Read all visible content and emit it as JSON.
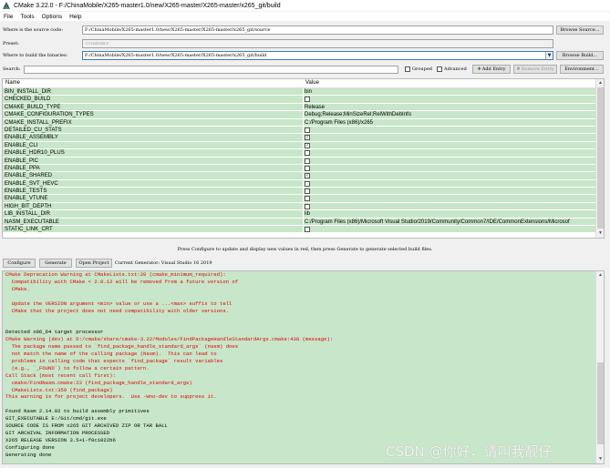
{
  "window": {
    "title": "CMake 3.22.0 - F:/ChinaMobile/X265-master1.0/new/X265-master/X265-master/x265_git/build"
  },
  "menu": [
    "File",
    "Tools",
    "Options",
    "Help"
  ],
  "source": {
    "label": "Where is the source code:",
    "value": "F:/ChinaMobile/X265-master1.0/new/X265-master/X265-master/x265_git/source",
    "button": "Browse Source..."
  },
  "preset": {
    "label": "Preset:",
    "value": "<custom>"
  },
  "binaries": {
    "label": "Where to build the binaries:",
    "value": "F:/ChinaMobile/X265-master1.0/new/X265-master/X265-master/x265_git/build",
    "button": "Browse Build..."
  },
  "search": {
    "label": "Search:",
    "value": "",
    "grouped": "Grouped",
    "advanced": "Advanced",
    "add_entry": "Add Entry",
    "remove_entry": "Remove Entry",
    "environment": "Environment..."
  },
  "table": {
    "headers": {
      "name": "Name",
      "value": "Value"
    },
    "rows": [
      {
        "name": "BIN_INSTALL_DIR",
        "value": "bin"
      },
      {
        "name": "CHECKED_BUILD",
        "checkbox": true,
        "checked": false
      },
      {
        "name": "CMAKE_BUILD_TYPE",
        "value": "Release"
      },
      {
        "name": "CMAKE_CONFIGURATION_TYPES",
        "value": "Debug;Release;MinSizeRel;RelWithDebInfo"
      },
      {
        "name": "CMAKE_INSTALL_PREFIX",
        "value": "C:/Program Files (x86)/x265"
      },
      {
        "name": "DETAILED_CU_STATS",
        "checkbox": true,
        "checked": false
      },
      {
        "name": "ENABLE_ASSEMBLY",
        "checkbox": true,
        "checked": true
      },
      {
        "name": "ENABLE_CLI",
        "checkbox": true,
        "checked": true
      },
      {
        "name": "ENABLE_HDR10_PLUS",
        "checkbox": true,
        "checked": false
      },
      {
        "name": "ENABLE_PIC",
        "checkbox": true,
        "checked": false
      },
      {
        "name": "ENABLE_PPA",
        "checkbox": true,
        "checked": false
      },
      {
        "name": "ENABLE_SHARED",
        "checkbox": true,
        "checked": true
      },
      {
        "name": "ENABLE_SVT_HEVC",
        "checkbox": true,
        "checked": false
      },
      {
        "name": "ENABLE_TESTS",
        "checkbox": true,
        "checked": false
      },
      {
        "name": "ENABLE_VTUNE",
        "checkbox": true,
        "checked": false
      },
      {
        "name": "HIGH_BIT_DEPTH",
        "checkbox": true,
        "checked": false
      },
      {
        "name": "LIB_INSTALL_DIR",
        "value": "lib"
      },
      {
        "name": "NASM_EXECUTABLE",
        "value": "C:/Program Files (x86)/Microsoft Visual Studio/2019/Community/Common7/IDE/CommonExtensions/Microsof"
      },
      {
        "name": "STATIC_LINK_CRT",
        "checkbox": true,
        "checked": false
      }
    ]
  },
  "hint": "Press Configure to update and display new values in red, then press Generate to generate selected build files.",
  "actions": {
    "configure": "Configure",
    "generate": "Generate",
    "open_project": "Open Project",
    "current_generator": "Current Generator: Visual Studio 16 2019"
  },
  "output": {
    "lines": [
      {
        "text": "CMake Deprecation Warning at CMakeLists.txt:20 (cmake_minimum_required):",
        "color": "red"
      },
      {
        "text": "  Compatibility with CMake < 2.8.12 will be removed from a future version of",
        "color": "red"
      },
      {
        "text": "  CMake.",
        "color": "red"
      },
      {
        "text": "",
        "color": "red"
      },
      {
        "text": "  Update the VERSION argument <min> value or use a ...<max> suffix to tell",
        "color": "red"
      },
      {
        "text": "  CMake that the project does not need compatibility with older versions.",
        "color": "red"
      },
      {
        "text": "",
        "color": "red"
      },
      {
        "text": "",
        "color": "black"
      },
      {
        "text": "Detected x86_64 target processor",
        "color": "black"
      },
      {
        "text": "CMake Warning (dev) at D:/cmake/share/cmake-3.22/Modules/FindPackageHandleStandardArgs.cmake:438 (message):",
        "color": "red"
      },
      {
        "text": "  The package name passed to `find_package_handle_standard_args` (nasm) does",
        "color": "red"
      },
      {
        "text": "  not match the name of the calling package (Nasm).  This can lead to",
        "color": "red"
      },
      {
        "text": "  problems in calling code that expects `find_package` result variables",
        "color": "red"
      },
      {
        "text": "  (e.g., `_FOUND`) to follow a certain pattern.",
        "color": "red"
      },
      {
        "text": "Call Stack (most recent call first):",
        "color": "red"
      },
      {
        "text": "  cmake/FindNasm.cmake:23 (find_package_handle_standard_args)",
        "color": "red"
      },
      {
        "text": "  CMakeLists.txt:359 (find_package)",
        "color": "red"
      },
      {
        "text": "This warning is for project developers.  Use -Wno-dev to suppress it.",
        "color": "red"
      },
      {
        "text": "",
        "color": "black"
      },
      {
        "text": "Found Nasm 2.14.02 to build assembly primitives",
        "color": "black"
      },
      {
        "text": "GIT_EXECUTABLE E:/Git/cmd/git.exe",
        "color": "black"
      },
      {
        "text": "SOURCE CODE IS FROM x265 GIT ARCHIVED ZIP OR TAR BALL",
        "color": "black"
      },
      {
        "text": "GIT ARCHIVAL INFORMATION PROCESSED",
        "color": "black"
      },
      {
        "text": "X265 RELEASE VERSION 3.5+1-f0c1022b6",
        "color": "black"
      },
      {
        "text": "Configuring done",
        "color": "black"
      },
      {
        "text": "Generating done",
        "color": "black"
      }
    ]
  },
  "watermark": "CSDN @你好，请叫我靓仔"
}
